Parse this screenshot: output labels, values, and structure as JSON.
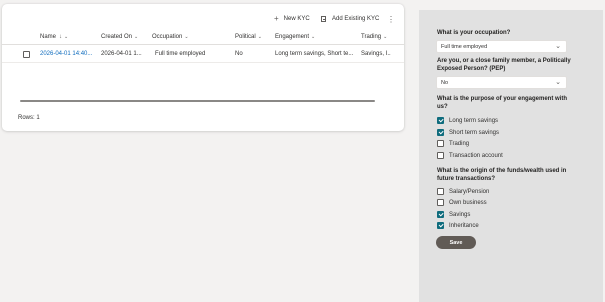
{
  "commands": {
    "new_kyc": "New KYC",
    "add_existing_kyc": "Add Existing KYC"
  },
  "grid": {
    "columns": [
      "Name",
      "Created On",
      "Occupation",
      "Political",
      "Engagement",
      "Trading"
    ],
    "name_sort_indicator": "↓",
    "rows": [
      {
        "name": "2026-04-01 14:40...",
        "created_on": "2026-04-01 1...",
        "occupation": "Full time employed",
        "political": "No",
        "engagement": "Long term savings, Short te...",
        "trading": "Savings, I..."
      }
    ],
    "rows_label": "Rows: 1"
  },
  "form": {
    "q_occupation": "What is your occupation?",
    "occupation_value": "Full time employed",
    "q_pep": "Are you, or a close family member, a Politically Exposed Person? (PEP)",
    "pep_value": "No",
    "q_purpose": "What is the purpose of your engagement with us?",
    "purpose_options": [
      {
        "label": "Long term savings",
        "checked": true
      },
      {
        "label": "Short term savings",
        "checked": true
      },
      {
        "label": "Trading",
        "checked": false
      },
      {
        "label": "Transaction account",
        "checked": false
      }
    ],
    "q_origin": "What is the origin of the funds/wealth used in future transactions?",
    "origin_options": [
      {
        "label": "Salary/Pension",
        "checked": false
      },
      {
        "label": "Own business",
        "checked": false
      },
      {
        "label": "Savings",
        "checked": true
      },
      {
        "label": "Inheritance",
        "checked": true
      }
    ],
    "save_label": "Save"
  },
  "colors": {
    "link": "#0f6cbd",
    "checkbox_checked": "#0f6c7d",
    "panel_background": "#e1e1e1",
    "save_button": "#615b56"
  },
  "icons": {
    "new": "plus-icon",
    "add_existing": "document-icon",
    "more": "more-vertical-icon",
    "dropdown": "chevron-down-icon"
  }
}
